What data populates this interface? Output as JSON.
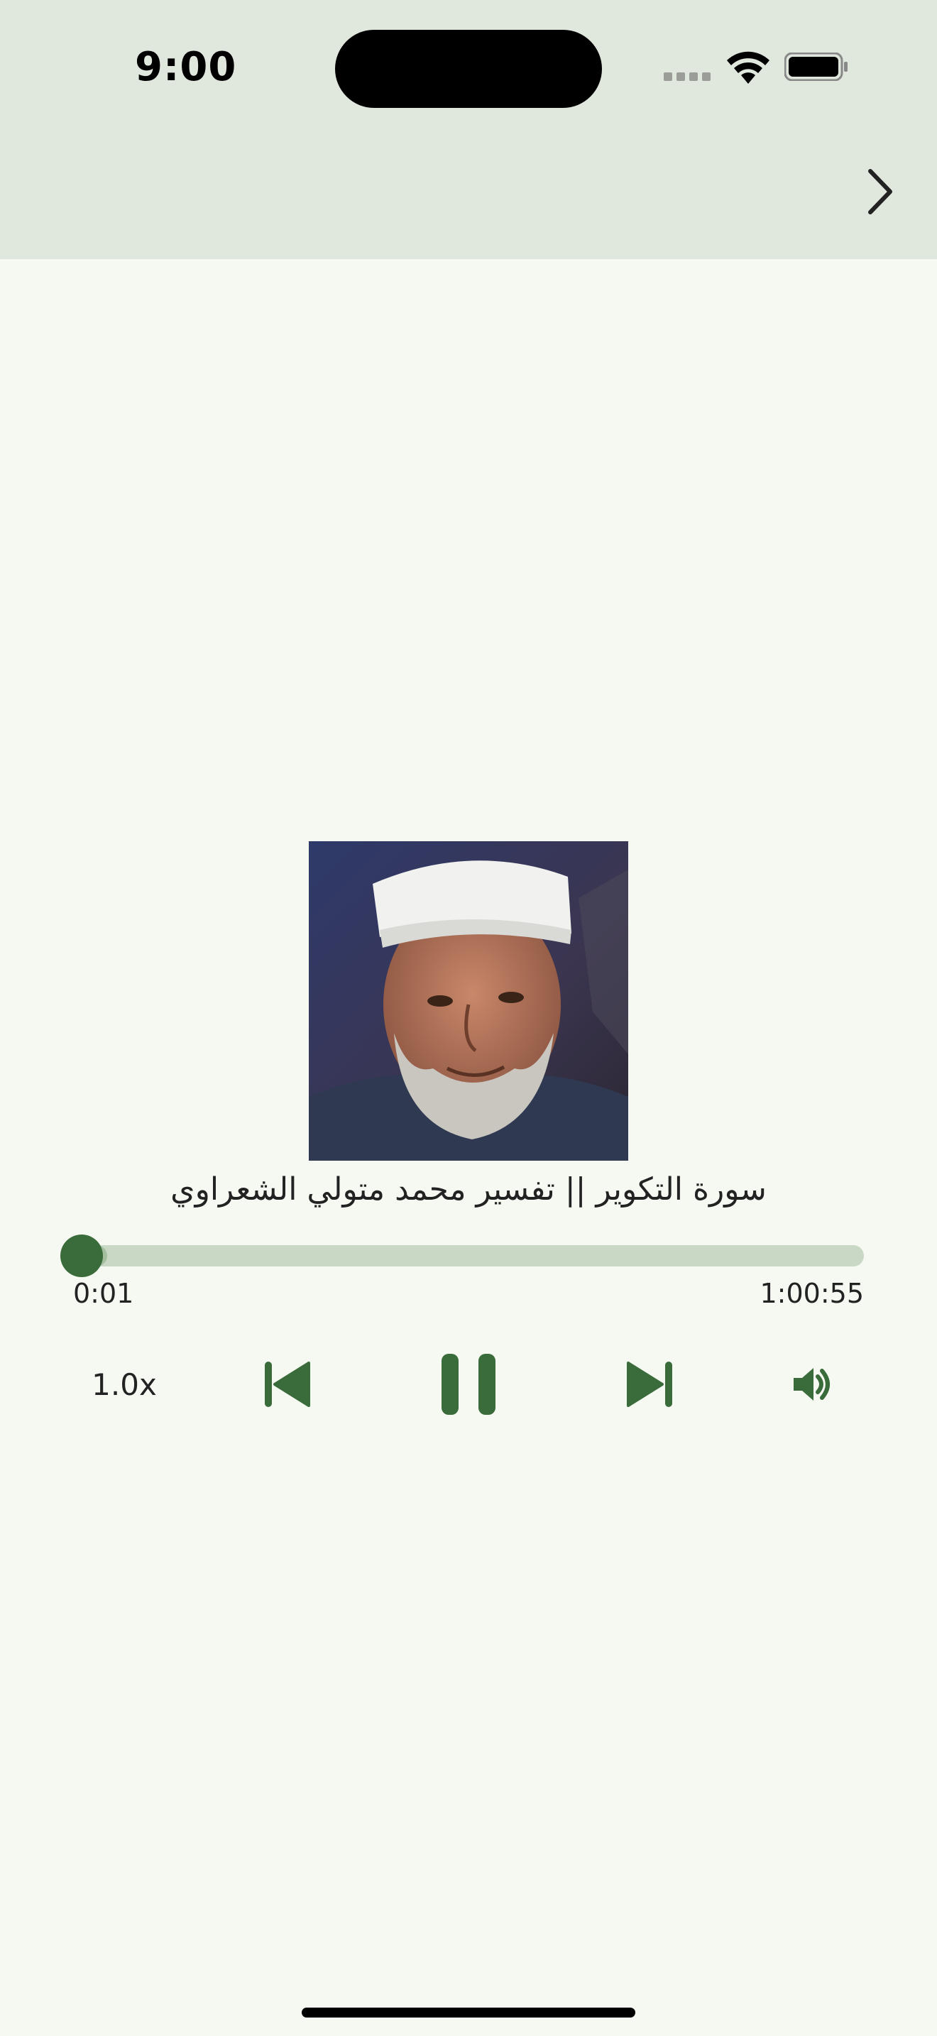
{
  "status_bar": {
    "time": "9:00"
  },
  "app_bar": {
    "forward_icon": "chevron-right-icon"
  },
  "player": {
    "artwork_icon": "portrait-image",
    "title": "سورة التكوير || تفسير محمد متولي الشعراوي",
    "current_time": "0:01",
    "total_time": "1:00:55",
    "progress_fraction": 0.0003,
    "buffered_fraction": 0.05,
    "speed_label": "1.0x",
    "prev_icon": "skip-previous-icon",
    "pause_icon": "pause-icon",
    "next_icon": "skip-next-icon",
    "volume_icon": "volume-icon"
  },
  "colors": {
    "accent": "#3a6b3a",
    "track": "#c8d8c4",
    "buffered": "#a6bea0",
    "background": "#f6f9f2",
    "bar": "#e0e8dd"
  }
}
